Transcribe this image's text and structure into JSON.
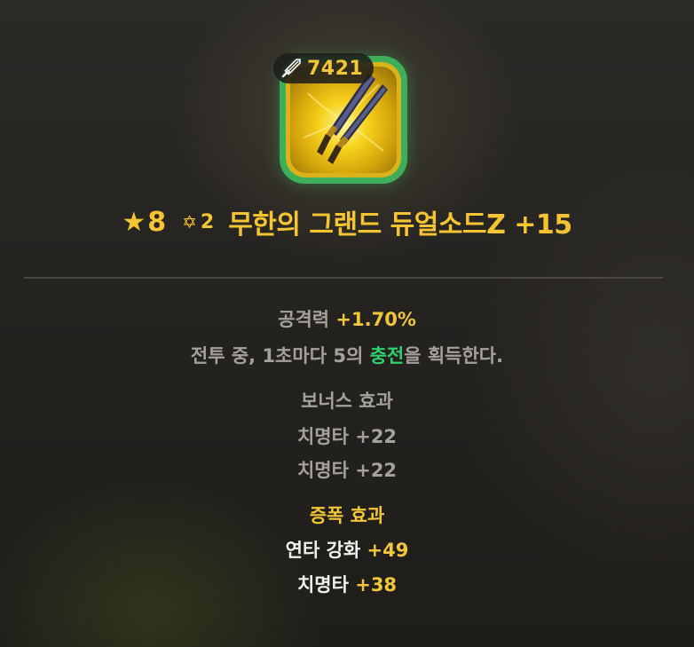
{
  "item": {
    "power_icon": "sword-icon",
    "power": "7421",
    "item_icon": "dual-sword-icon",
    "frame_color": "#3dae5a",
    "star_icon": "★",
    "star_count": "8",
    "sub_star_icon": "✡",
    "sub_star_count": "2",
    "name": "무한의 그랜드 듀얼소드Z +15"
  },
  "colors": {
    "gold": "#f1c63a",
    "gray": "#a4a19c",
    "green": "#2fcf6e",
    "white": "#f2f0ec"
  },
  "main_stat": {
    "label": "공격력 ",
    "value": "+1.70%"
  },
  "passive": {
    "prefix": "전투 중, 1초마다 5의 ",
    "highlight": "충전",
    "suffix": "을 획득한다."
  },
  "bonus": {
    "title": "보너스 효과",
    "lines": [
      "치명타 +22",
      "치명타 +22"
    ]
  },
  "amplify": {
    "title": "증폭 효과",
    "lines": [
      {
        "label": "연타 강화 ",
        "value": "+49"
      },
      {
        "label": "치명타 ",
        "value": "+38"
      }
    ]
  }
}
